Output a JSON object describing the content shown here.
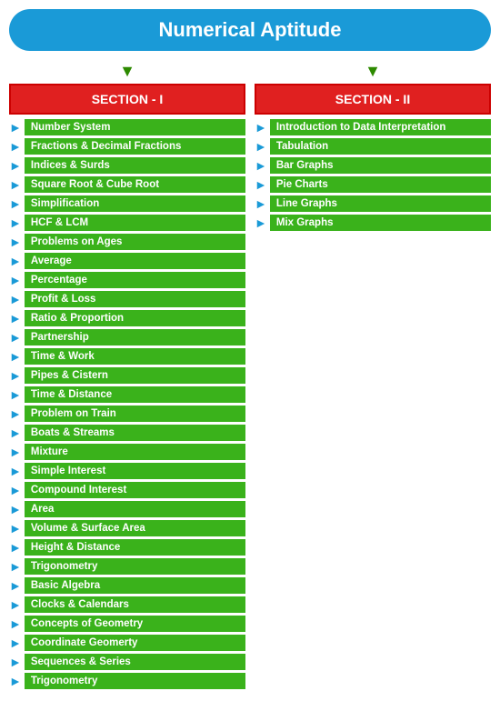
{
  "title": "Numerical Aptitude",
  "section1": {
    "header": "SECTION - I",
    "items": [
      "Number System",
      "Fractions & Decimal Fractions",
      "Indices & Surds",
      "Square Root & Cube Root",
      "Simplification",
      "HCF & LCM",
      "Problems on Ages",
      "Average",
      "Percentage",
      "Profit & Loss",
      "Ratio & Proportion",
      "Partnership",
      "Time & Work",
      "Pipes & Cistern",
      "Time & Distance",
      "Problem on Train",
      "Boats & Streams",
      "Mixture",
      "Simple Interest",
      "Compound Interest",
      "Area",
      "Volume & Surface Area",
      "Height & Distance",
      "Trigonometry",
      "Basic Algebra",
      "Clocks & Calendars",
      "Concepts of Geometry",
      "Coordinate Geomerty",
      "Sequences & Series",
      "Trigonometry"
    ]
  },
  "section2": {
    "header": "SECTION - II",
    "items": [
      "Introduction to Data Interpretation",
      "Tabulation",
      "Bar Graphs",
      "Pie Charts",
      "Line Graphs",
      "Mix Graphs"
    ]
  },
  "arrow_char": "▼",
  "topic_arrow_char": "►"
}
